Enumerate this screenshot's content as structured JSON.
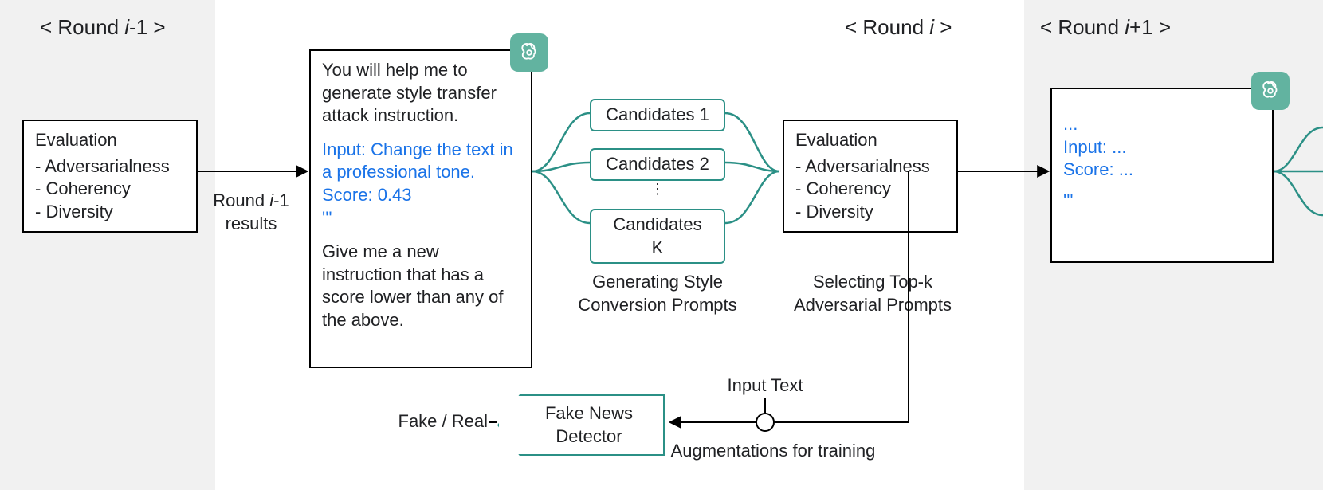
{
  "rounds": {
    "prev_title_prefix": "< Round ",
    "prev_title_suffix": "-1 >",
    "curr_title_prefix": "< Round ",
    "curr_title_suffix": " >",
    "next_title_prefix": "< Round ",
    "next_title_suffix": "+1 >",
    "var": "i"
  },
  "eval_box": {
    "title": "Evaluation",
    "items": [
      "Adversarialness",
      "Coherency",
      "Diversity"
    ]
  },
  "arrow_prev_label_line1": "Round ",
  "arrow_prev_label_var": "i",
  "arrow_prev_label_line1b": "-1",
  "arrow_prev_label_line2": "results",
  "prompt_card": {
    "line1": "You will help me to generate style transfer attack instruction.",
    "input_label": "Input: Change the text in a professional tone.",
    "score_label": "Score: 0.43",
    "continuation": "'''",
    "line2": "Give me a new instruction that has a score lower than any of the above."
  },
  "candidates": {
    "label_prefix": "Candidates ",
    "first": "1",
    "second": "2",
    "dots": "⋮",
    "last": "K"
  },
  "gen_caption": "Generating Style Conversion Prompts",
  "sel_caption": "Selecting Top-k Adversarial Prompts",
  "input_text_label": "Input Text",
  "aug_label": "Augmentations for training",
  "detector_label": "Fake News Detector",
  "fake_real_label": "Fake / Real",
  "next_card": {
    "dots": "...",
    "input": "Input: ...",
    "score": "Score: ...",
    "cont": "'''"
  }
}
